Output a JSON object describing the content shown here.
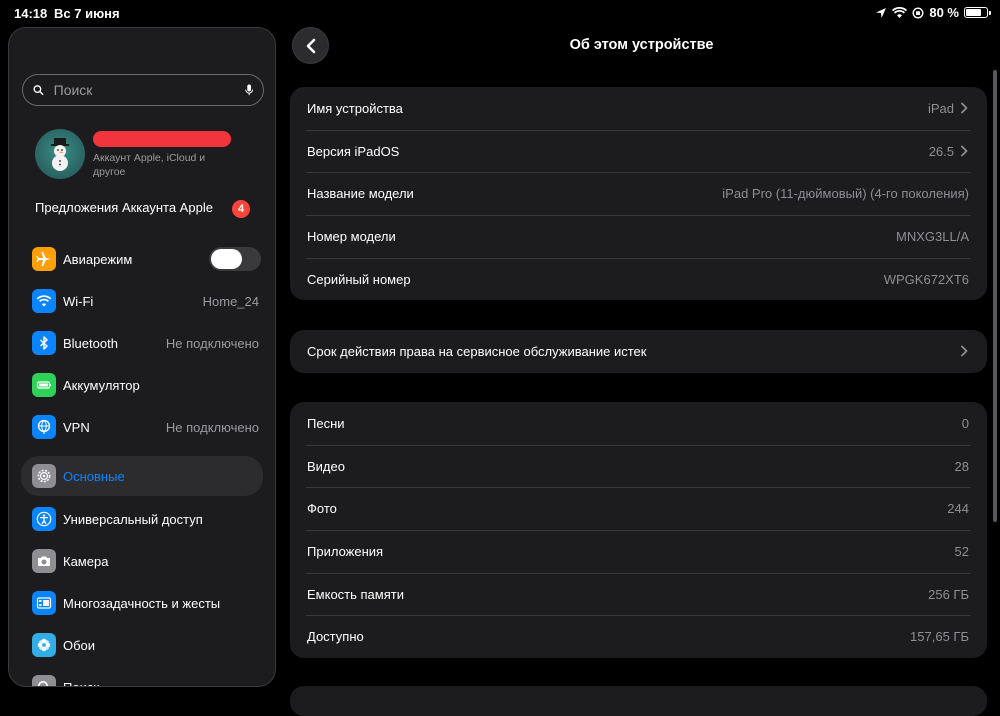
{
  "status": {
    "time": "14:18",
    "date": "Вс 7 июня",
    "battery": "80 %",
    "battery_level": 0.8
  },
  "sidebar": {
    "search": {
      "placeholder": "Поиск"
    },
    "profile": {
      "name": "████████████",
      "subtitle": "Аккаунт Apple, iCloud и другое"
    },
    "offers": {
      "label": "Предложения Аккаунта Apple",
      "count": "4"
    },
    "items": [
      {
        "label": "Авиарежим",
        "value": "",
        "toggle": false,
        "color": "#ff9f0a",
        "icon": "airplane-icon"
      },
      {
        "label": "Wi-Fi",
        "value": "Home_24",
        "color": "#0a84ff",
        "icon": "wifi-icon"
      },
      {
        "label": "Bluetooth",
        "value": "Не подключено",
        "color": "#0a84ff",
        "icon": "bluetooth-icon"
      },
      {
        "label": "Аккумулятор",
        "value": "",
        "color": "#30d158",
        "icon": "battery-icon"
      },
      {
        "label": "VPN",
        "value": "Не подключено",
        "color": "#0a84ff",
        "icon": "globe-icon"
      },
      {
        "label": "Основные",
        "value": "",
        "color": "#8e8e93",
        "icon": "gear-icon",
        "active": true
      },
      {
        "label": "Универсальный доступ",
        "value": "",
        "color": "#0a84ff",
        "icon": "accessibility-icon"
      },
      {
        "label": "Камера",
        "value": "",
        "color": "#8e8e93",
        "icon": "camera-icon"
      },
      {
        "label": "Многозадачность и жесты",
        "value": "",
        "color": "#0a84ff",
        "icon": "multitasking-icon"
      },
      {
        "label": "Обои",
        "value": "",
        "color": "#32ade6",
        "icon": "wallpaper-icon"
      },
      {
        "label": "Поиск",
        "value": "",
        "color": "#8e8e93",
        "icon": "search-icon"
      }
    ]
  },
  "main": {
    "title": "Об этом устройстве",
    "group1": [
      {
        "label": "Имя устройства",
        "value": "iPad",
        "chevron": true
      },
      {
        "label": "Версия iPadOS",
        "value": "26.5",
        "chevron": true
      },
      {
        "label": "Название модели",
        "value": "iPad Pro (11-дюймовый) (4-го поколения)"
      },
      {
        "label": "Номер модели",
        "value": "MNXG3LL/A"
      },
      {
        "label": "Серийный номер",
        "value": "WPGK672XT6"
      }
    ],
    "group2": [
      {
        "label": "Срок действия права на сервисное обслуживание истек",
        "value": "",
        "chevron": true
      }
    ],
    "group3": [
      {
        "label": "Песни",
        "value": "0"
      },
      {
        "label": "Видео",
        "value": "28"
      },
      {
        "label": "Фото",
        "value": "244"
      },
      {
        "label": "Приложения",
        "value": "52"
      },
      {
        "label": "Емкость памяти",
        "value": "256 ГБ"
      },
      {
        "label": "Доступно",
        "value": "157,65 ГБ"
      }
    ]
  }
}
